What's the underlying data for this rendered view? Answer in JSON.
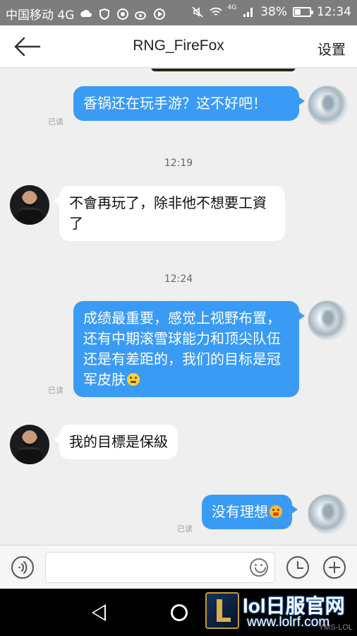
{
  "status_bar": {
    "carrier": "中国移动 4G",
    "network_badge": "4G",
    "battery": "38%",
    "time": "12:34",
    "icons": [
      "weather-icon",
      "shield-icon",
      "qq-icon",
      "weibo-icon",
      "play-icon",
      "mute-icon",
      "wifi-icon",
      "signal-icon",
      "battery-icon"
    ]
  },
  "header": {
    "title": "RNG_FireFox",
    "settings_label": "设置"
  },
  "messages": [
    {
      "side": "out",
      "text": "香锅还在玩手游？这不好吧！",
      "read": "已读"
    },
    {
      "type": "time",
      "text": "12:19"
    },
    {
      "side": "in",
      "text": "不會再玩了，除非他不想要工資了"
    },
    {
      "type": "time",
      "text": "12:24"
    },
    {
      "side": "out",
      "text": "成绩最重要，感觉上视野布置，还有中期滚雪球能力和顶尖队伍还是有差距的，我们的目标是冠军皮肤",
      "read": "已读",
      "emoji": "thinking-emoji"
    },
    {
      "side": "in",
      "text": "我的目標是保級"
    },
    {
      "side": "out",
      "text": "没有理想",
      "read": "已读",
      "emoji": "crying-emoji"
    }
  ],
  "watermark": {
    "site_name": "lol日服官网",
    "url": "www.lolrf.com",
    "corner": "YMS-LOL"
  }
}
